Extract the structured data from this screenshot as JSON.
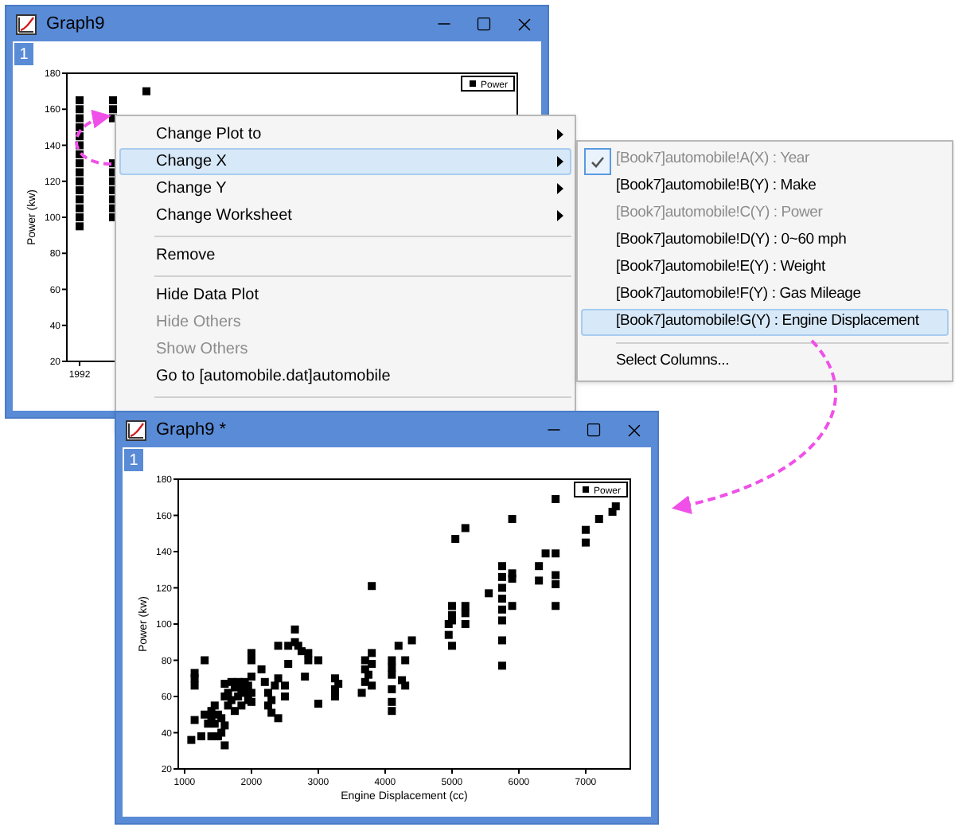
{
  "windows": [
    {
      "title": "Graph9",
      "layer": "1",
      "plot": {
        "ylabel": "Power (kw)",
        "yticks": [
          "180",
          "160",
          "140",
          "120",
          "100",
          "80",
          "60",
          "40",
          "20"
        ],
        "xtick": "1992",
        "legend": "Power"
      }
    },
    {
      "title": "Graph9 *",
      "layer": "1",
      "chart_data": {
        "type": "scatter",
        "xlabel": "Engine Displacement (cc)",
        "ylabel": "Power (kw)",
        "x": [
          1100,
          1150,
          1150,
          1150,
          1150,
          1250,
          1300,
          1300,
          1350,
          1400,
          1400,
          1400,
          1450,
          1450,
          1500,
          1500,
          1550,
          1550,
          1600,
          1600,
          1600,
          1600,
          1650,
          1650,
          1700,
          1700,
          1750,
          1750,
          1800,
          1800,
          1850,
          1850,
          1900,
          1900,
          1950,
          1950,
          2000,
          2000,
          2000,
          2000,
          2000,
          2150,
          2200,
          2250,
          2250,
          2300,
          2300,
          2350,
          2400,
          2400,
          2400,
          2500,
          2500,
          2550,
          2550,
          2650,
          2650,
          2700,
          2750,
          2800,
          2850,
          2850,
          3000,
          3000,
          3250,
          3250,
          3250,
          3300,
          3650,
          3700,
          3700,
          3700,
          3750,
          3800,
          3800,
          3800,
          3800,
          4100,
          4100,
          4100,
          4100,
          4100,
          4100,
          4200,
          4250,
          4300,
          4300,
          4400,
          4950,
          4950,
          5000,
          5000,
          5000,
          5000,
          5050,
          5200,
          5200,
          5200,
          5200,
          5550,
          5750,
          5750,
          5750,
          5750,
          5750,
          5750,
          5750,
          5750,
          5900,
          5900,
          5900,
          5900,
          6300,
          6300,
          6400,
          6550,
          6550,
          6550,
          6550,
          6550,
          7000,
          7000,
          7200,
          7400,
          7450
        ],
        "series": [
          {
            "name": "Power",
            "color": "#000000",
            "values": [
              36,
              47,
              66,
              70,
              73,
              38,
              80,
              50,
              45,
              48,
              52,
              38,
              45,
              55,
              50,
              38,
              48,
              40,
              33,
              60,
              67,
              44,
              62,
              55,
              68,
              58,
              52,
              65,
              60,
              68,
              64,
              55,
              62,
              68,
              58,
              66,
              57,
              62,
              71,
              80,
              84,
              75,
              68,
              62,
              55,
              58,
              51,
              66,
              48,
              70,
              88,
              60,
              66,
              78,
              88,
              90,
              97,
              88,
              85,
              71,
              80,
              84,
              80,
              56,
              60,
              64,
              70,
              67,
              62,
              68,
              75,
              80,
              72,
              84,
              66,
              121,
              78,
              52,
              57,
              64,
              72,
              76,
              80,
              88,
              69,
              66,
              80,
              91,
              94,
              100,
              88,
              102,
              110,
              105,
              147,
              100,
              106,
              110,
              153,
              117,
              77,
              91,
              102,
              108,
              114,
              120,
              126,
              132,
              110,
              125,
              128,
              158,
              124,
              132,
              139,
              110,
              122,
              127,
              139,
              169,
              145,
              152,
              158,
              162,
              165
            ]
          }
        ],
        "xlim": [
          905,
          7667
        ],
        "ylim": [
          20,
          180
        ],
        "xticks": [
          1000,
          2000,
          3000,
          4000,
          5000,
          6000,
          7000
        ],
        "yticks": [
          20,
          40,
          60,
          80,
          100,
          120,
          140,
          160,
          180
        ]
      }
    }
  ],
  "context_menu": {
    "items": [
      {
        "kind": "item",
        "label": "Change Plot to",
        "selected": false,
        "disabled": false,
        "submenu": true
      },
      {
        "kind": "item",
        "label": "Change X",
        "selected": true,
        "disabled": false,
        "submenu": true
      },
      {
        "kind": "item",
        "label": "Change Y",
        "selected": false,
        "disabled": false,
        "submenu": true
      },
      {
        "kind": "item",
        "label": "Change Worksheet",
        "selected": false,
        "disabled": false,
        "submenu": true
      },
      {
        "kind": "separator"
      },
      {
        "kind": "item",
        "label": "Remove",
        "selected": false,
        "disabled": false,
        "submenu": false
      },
      {
        "kind": "separator"
      },
      {
        "kind": "item",
        "label": "Hide Data Plot",
        "selected": false,
        "disabled": false,
        "submenu": false
      },
      {
        "kind": "item",
        "label": "Hide Others",
        "selected": false,
        "disabled": true,
        "submenu": false
      },
      {
        "kind": "item",
        "label": "Show Others",
        "selected": false,
        "disabled": true,
        "submenu": false
      },
      {
        "kind": "item",
        "label": "Go to [automobile.dat]automobile",
        "selected": false,
        "disabled": false,
        "submenu": false
      },
      {
        "kind": "separator"
      }
    ]
  },
  "submenu": {
    "items": [
      {
        "kind": "item",
        "label": "[Book7]automobile!A(X) : Year",
        "checked": true,
        "disabled": true,
        "selected": false
      },
      {
        "kind": "item",
        "label": "[Book7]automobile!B(Y) : Make",
        "checked": false,
        "disabled": false,
        "selected": false
      },
      {
        "kind": "item",
        "label": "[Book7]automobile!C(Y) : Power",
        "checked": false,
        "disabled": true,
        "selected": false
      },
      {
        "kind": "item",
        "label": "[Book7]automobile!D(Y) : 0~60 mph",
        "checked": false,
        "disabled": false,
        "selected": false
      },
      {
        "kind": "item",
        "label": "[Book7]automobile!E(Y) : Weight",
        "checked": false,
        "disabled": false,
        "selected": false
      },
      {
        "kind": "item",
        "label": "[Book7]automobile!F(Y) : Gas Mileage",
        "checked": false,
        "disabled": false,
        "selected": false
      },
      {
        "kind": "item",
        "label": "[Book7]automobile!G(Y) : Engine Displacement",
        "checked": false,
        "disabled": false,
        "selected": true
      },
      {
        "kind": "separator"
      },
      {
        "kind": "item",
        "label": "Select Columns...",
        "checked": false,
        "disabled": false,
        "selected": false
      }
    ]
  }
}
